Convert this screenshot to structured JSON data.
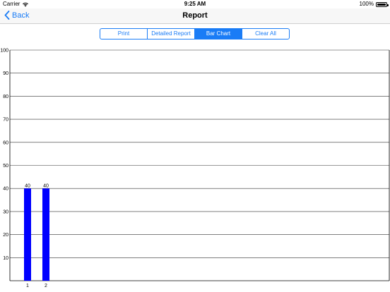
{
  "status_bar": {
    "carrier": "Carrier",
    "time": "9:25 AM",
    "battery": "100%",
    "wifi_icon": "wifi-icon",
    "battery_icon": "battery-icon"
  },
  "nav": {
    "back_label": "Back",
    "back_icon": "chevron-left-icon",
    "title": "Report",
    "accent": "#1a7cf6"
  },
  "segments": [
    {
      "label": "Print",
      "selected": false
    },
    {
      "label": "Detailed Report",
      "selected": false
    },
    {
      "label": "Bar Chart",
      "selected": true
    },
    {
      "label": "Clear All",
      "selected": false
    }
  ],
  "chart_data": {
    "type": "bar",
    "categories": [
      "1",
      "2"
    ],
    "values": [
      40,
      40
    ],
    "data_labels": [
      "40",
      "40"
    ],
    "ylim": [
      0,
      100
    ],
    "yticks": [
      10,
      20,
      30,
      40,
      50,
      60,
      70,
      80,
      90,
      100
    ],
    "grid": true,
    "bar_color": "#0000ff",
    "title": "",
    "xlabel": "",
    "ylabel": ""
  }
}
